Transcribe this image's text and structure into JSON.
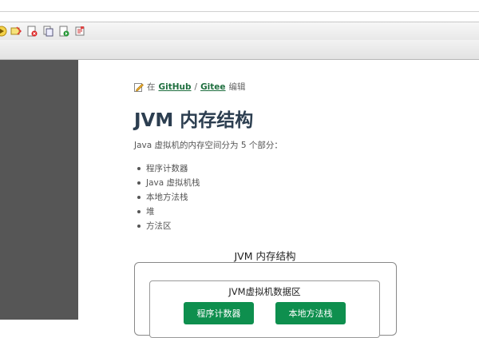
{
  "toolbar": {
    "icons": [
      "play-icon",
      "edit-tag-icon",
      "delete-page-icon",
      "copy-page-icon",
      "refresh-page-icon",
      "save-page-icon"
    ]
  },
  "page": {
    "edit_prefix": "在",
    "github_link": "GitHub",
    "separator": "/",
    "gitee_link": "Gitee",
    "edit_suffix": "编辑",
    "title": "JVM 内存结构",
    "intro": "Java 虚拟机的内存空间分为 5 个部分：",
    "list_items": [
      "程序计数器",
      "Java 虚拟机栈",
      "本地方法栈",
      "堆",
      "方法区"
    ]
  },
  "diagram": {
    "title": "JVM 内存结构",
    "inner_title": "JVM虚拟机数据区",
    "regions": [
      "程序计数器",
      "本地方法栈"
    ],
    "region_color": "#0e8f4e"
  }
}
